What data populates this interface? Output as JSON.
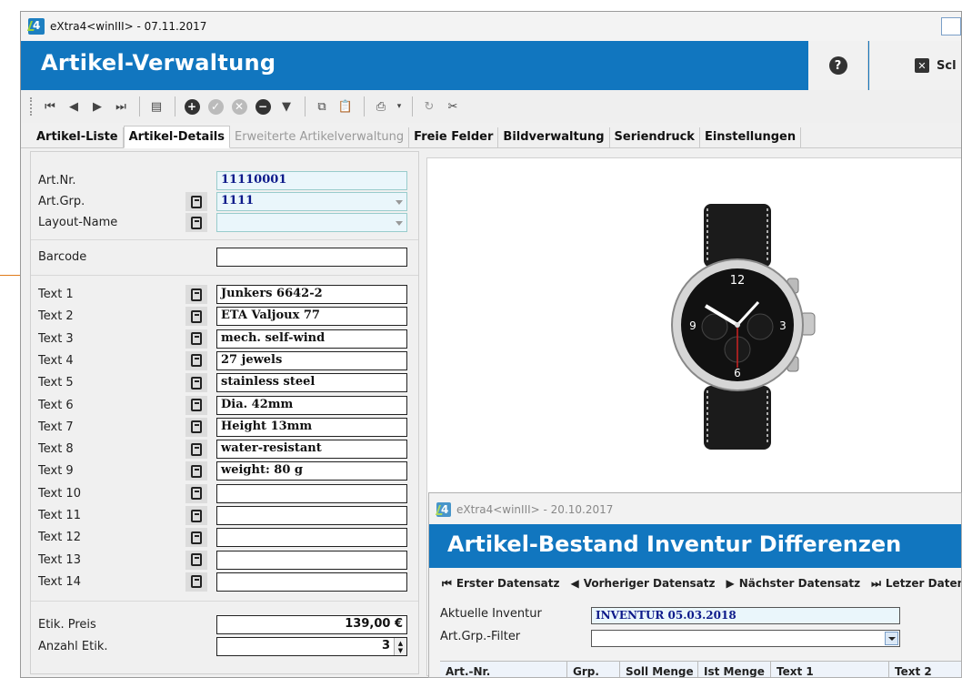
{
  "main_window": {
    "title": "eXtra4<winIII> - 07.11.2017",
    "header_title": "Artikel-Verwaltung",
    "help_label": "?",
    "close_label": "Scl"
  },
  "tabs": [
    {
      "label": "Artikel-Liste",
      "state": "normal"
    },
    {
      "label": "Artikel-Details",
      "state": "active"
    },
    {
      "label": "Erweiterte Artikelverwaltung",
      "state": "disabled"
    },
    {
      "label": "Freie Felder",
      "state": "normal"
    },
    {
      "label": "Bildverwaltung",
      "state": "normal"
    },
    {
      "label": "Seriendruck",
      "state": "normal"
    },
    {
      "label": "Einstellungen",
      "state": "normal"
    }
  ],
  "form": {
    "art_nr": {
      "label": "Art.Nr.",
      "value": "11110001"
    },
    "art_grp": {
      "label": "Art.Grp.",
      "value": "1111"
    },
    "layout_name": {
      "label": "Layout-Name",
      "value": ""
    },
    "barcode": {
      "label": "Barcode",
      "value": ""
    },
    "texts": [
      {
        "label": "Text 1",
        "value": "Junkers 6642-2"
      },
      {
        "label": "Text 2",
        "value": "ETA Valjoux 77"
      },
      {
        "label": "Text 3",
        "value": "mech. self-wind"
      },
      {
        "label": "Text 4",
        "value": "27 jewels"
      },
      {
        "label": "Text 5",
        "value": "stainless steel"
      },
      {
        "label": "Text 6",
        "value": "Dia. 42mm"
      },
      {
        "label": "Text 7",
        "value": "Height 13mm"
      },
      {
        "label": "Text 8",
        "value": "water-resistant"
      },
      {
        "label": "Text 9",
        "value": "weight: 80 g"
      },
      {
        "label": "Text 10",
        "value": ""
      },
      {
        "label": "Text 11",
        "value": ""
      },
      {
        "label": "Text 12",
        "value": ""
      },
      {
        "label": "Text 13",
        "value": ""
      },
      {
        "label": "Text 14",
        "value": ""
      }
    ],
    "etik_preis": {
      "label": "Etik. Preis",
      "value": "139,00 €"
    },
    "anzahl_etik": {
      "label": "Anzahl Etik.",
      "value": "3"
    }
  },
  "second_window": {
    "title": "eXtra4<winIII> - 20.10.2017",
    "header_title": "Artikel-Bestand Inventur Differenzen",
    "nav": [
      "Erster Datensatz",
      "Vorheriger Datensatz",
      "Nächster Datensatz",
      "Letzer Datensat"
    ],
    "aktuelle_inventur": {
      "label": "Aktuelle Inventur",
      "value": "INVENTUR 05.03.2018"
    },
    "grp_filter": {
      "label": "Art.Grp.-Filter",
      "value": ""
    },
    "columns": [
      "Art.-Nr.",
      "Grp.",
      "Soll Menge",
      "Ist Menge",
      "Text 1",
      "Text 2"
    ]
  },
  "colors": {
    "header_blue": "#1176bf",
    "field_blue_text": "#0d1a8a",
    "accent_orange": "#e07b1a"
  }
}
